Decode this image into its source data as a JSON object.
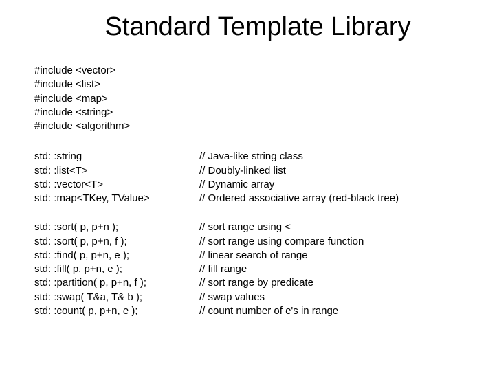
{
  "title": "Standard Template Library",
  "includes": [
    "#include <vector>",
    "#include <list>",
    "#include <map>",
    "#include <string>",
    "#include <algorithm>"
  ],
  "types": [
    {
      "left": "std: :string",
      "right": "// Java-like string class"
    },
    {
      "left": "std: :list<T>",
      "right": "// Doubly-linked list"
    },
    {
      "left": "std: :vector<T>",
      "right": "// Dynamic array"
    },
    {
      "left": "std: :map<TKey, TValue>",
      "right": "// Ordered associative array (red-black tree)"
    }
  ],
  "funcs": [
    {
      "left": "std: :sort( p, p+n );",
      "right": "// sort range using <"
    },
    {
      "left": "std: :sort( p, p+n, f );",
      "right": "// sort range using compare function"
    },
    {
      "left": "std: :find( p, p+n, e );",
      "right": "// linear search of range"
    },
    {
      "left": "std: :fill( p, p+n, e );",
      "right": "// fill range"
    },
    {
      "left": "std: :partition( p, p+n, f );",
      "right": "// sort range by predicate"
    },
    {
      "left": "std: :swap( T&a, T& b );",
      "right": "// swap values"
    },
    {
      "left": "std: :count( p, p+n, e );",
      "right": "// count number of e's in range"
    }
  ]
}
